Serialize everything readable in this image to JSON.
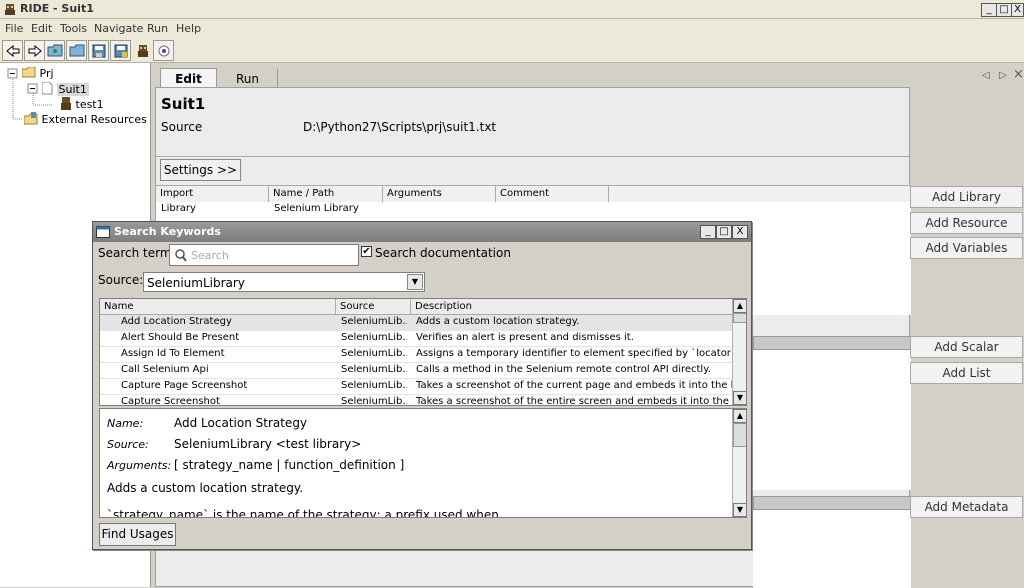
{
  "window": {
    "title": "RIDE - Suit1",
    "controls": [
      "_",
      "□",
      "X"
    ]
  },
  "menu": [
    "File",
    "Edit",
    "Tools",
    "Navigate",
    "Run",
    "Help"
  ],
  "toolbar": {
    "icons": [
      "back-arrow-icon",
      "forward-arrow-icon",
      "open-folder-icon",
      "open-directory-icon",
      "save-icon",
      "save-all-icon",
      "robot-icon",
      "stop-icon"
    ]
  },
  "tree": {
    "prj": "Prj",
    "suit1": "Suit1",
    "test1": "test1",
    "external": "External Resources"
  },
  "tabs": {
    "edit": "Edit",
    "run": "Run",
    "nav_prev": "◁",
    "nav_next": "▷",
    "close": "×"
  },
  "suite": {
    "name": "Suit1",
    "source_label": "Source",
    "source_path": "D:\\Python27\\Scripts\\prj\\suit1.txt",
    "settings_button": "Settings >>"
  },
  "imports_table": {
    "headers": [
      "Import",
      "Name / Path",
      "Arguments",
      "Comment"
    ],
    "rows": [
      [
        "Library",
        "Selenium Library",
        "",
        ""
      ]
    ]
  },
  "side_buttons": {
    "add_library": "Add Library",
    "add_resource": "Add Resource",
    "add_variables": "Add Variables",
    "add_scalar": "Add Scalar",
    "add_list": "Add List",
    "add_metadata": "Add Metadata"
  },
  "dialog": {
    "title": "Search Keywords",
    "search_term_label": "Search term:",
    "search_placeholder": "Search",
    "search_documentation_label": "Search documentation",
    "search_documentation_checked": true,
    "source_label": "Source:",
    "source_value": "SeleniumLibrary",
    "headers": [
      "Name",
      "Source",
      "Description"
    ],
    "rows": [
      {
        "name": "Add Location Strategy",
        "source": "SeleniumLib...",
        "desc": "Adds a custom location strategy."
      },
      {
        "name": "Alert Should Be Present",
        "source": "SeleniumLib...",
        "desc": "Verifies an alert is present and dismisses it."
      },
      {
        "name": "Assign Id To Element",
        "source": "SeleniumLib...",
        "desc": "Assigns a temporary identifier to element specified by `locator`."
      },
      {
        "name": "Call Selenium Api",
        "source": "SeleniumLib...",
        "desc": "Calls a method in the Selenium remote control API directly."
      },
      {
        "name": "Capture Page Screenshot",
        "source": "SeleniumLib...",
        "desc": "Takes a screenshot of the current page and embeds it into the log."
      },
      {
        "name": "Capture Screenshot",
        "source": "SeleniumLib...",
        "desc": "Takes a screenshot of the entire screen and embeds it into the log."
      }
    ],
    "details": {
      "name_label": "Name:",
      "name_value": "Add Location Strategy",
      "source_label": "Source:",
      "source_value": "SeleniumLibrary <test library>",
      "arguments_label": "Arguments:",
      "arguments_value": "[ strategy_name | function_definition ]",
      "description": "Adds a custom location strategy.",
      "doc_cut": "`strategy_name` is the name of the strategy; a prefix used when"
    },
    "find_usages": "Find Usages"
  }
}
